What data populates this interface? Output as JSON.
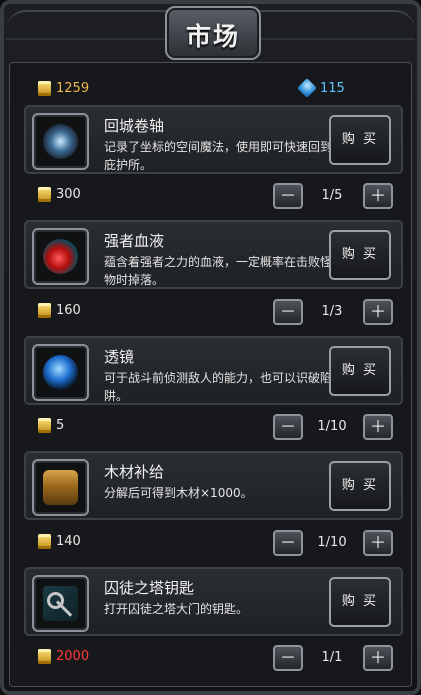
{
  "title": "市场",
  "currency": {
    "gold": "1259",
    "gems": "115",
    "gold_color": "#f0b64a",
    "gem_color": "#62c2ff"
  },
  "items": [
    {
      "name": "回城卷轴",
      "desc": "记录了坐标的空间魔法，使用即可快速回到庇护所。",
      "buy": "购 买",
      "price": "300",
      "count": "1/5",
      "icon": "scroll-icon"
    },
    {
      "name": "强者血液",
      "desc": "蕴含着强者之力的血液，一定概率在击败怪物时掉落。",
      "buy": "购 买",
      "price": "160",
      "count": "1/3",
      "icon": "blood-drop-icon"
    },
    {
      "name": "透镜",
      "desc": "可于战斗前侦测敌人的能力，也可以识破陷阱。",
      "buy": "购 买",
      "price": "5",
      "count": "1/10",
      "icon": "lens-icon"
    },
    {
      "name": "木材补给",
      "desc": "分解后可得到木材×1000。",
      "buy": "购 买",
      "price": "140",
      "count": "1/10",
      "icon": "chest-icon"
    },
    {
      "name": "囚徒之塔钥匙",
      "desc": "打开囚徒之塔大门的钥匙。",
      "buy": "购 买",
      "price": "2000",
      "count": "1/1",
      "icon": "key-icon",
      "price_color": "#ff3b3b"
    }
  ],
  "stepper": {
    "minus": "－",
    "plus": "＋"
  }
}
